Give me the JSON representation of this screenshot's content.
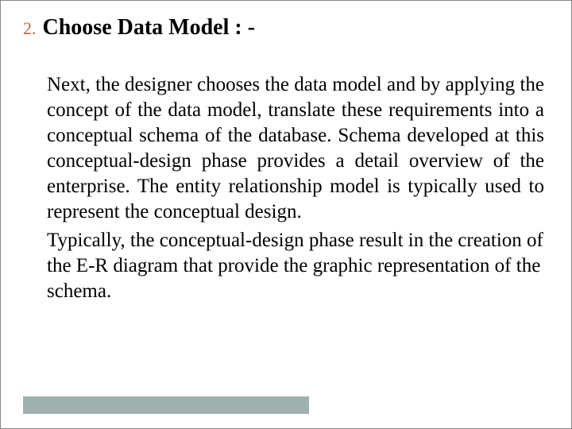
{
  "list": {
    "number": "2.",
    "heading": "Choose Data Model : -"
  },
  "body": {
    "para1": "Next, the designer chooses the data model and by applying the concept of the data model, translate these requirements into a conceptual schema of the database. Schema developed at this conceptual-design phase provides a detail overview of the enterprise. The entity relationship model is typically used to represent the conceptual design.",
    "para2": "Typically, the conceptual-design phase result in the creation of the E-R diagram that provide the graphic representation of the schema."
  }
}
